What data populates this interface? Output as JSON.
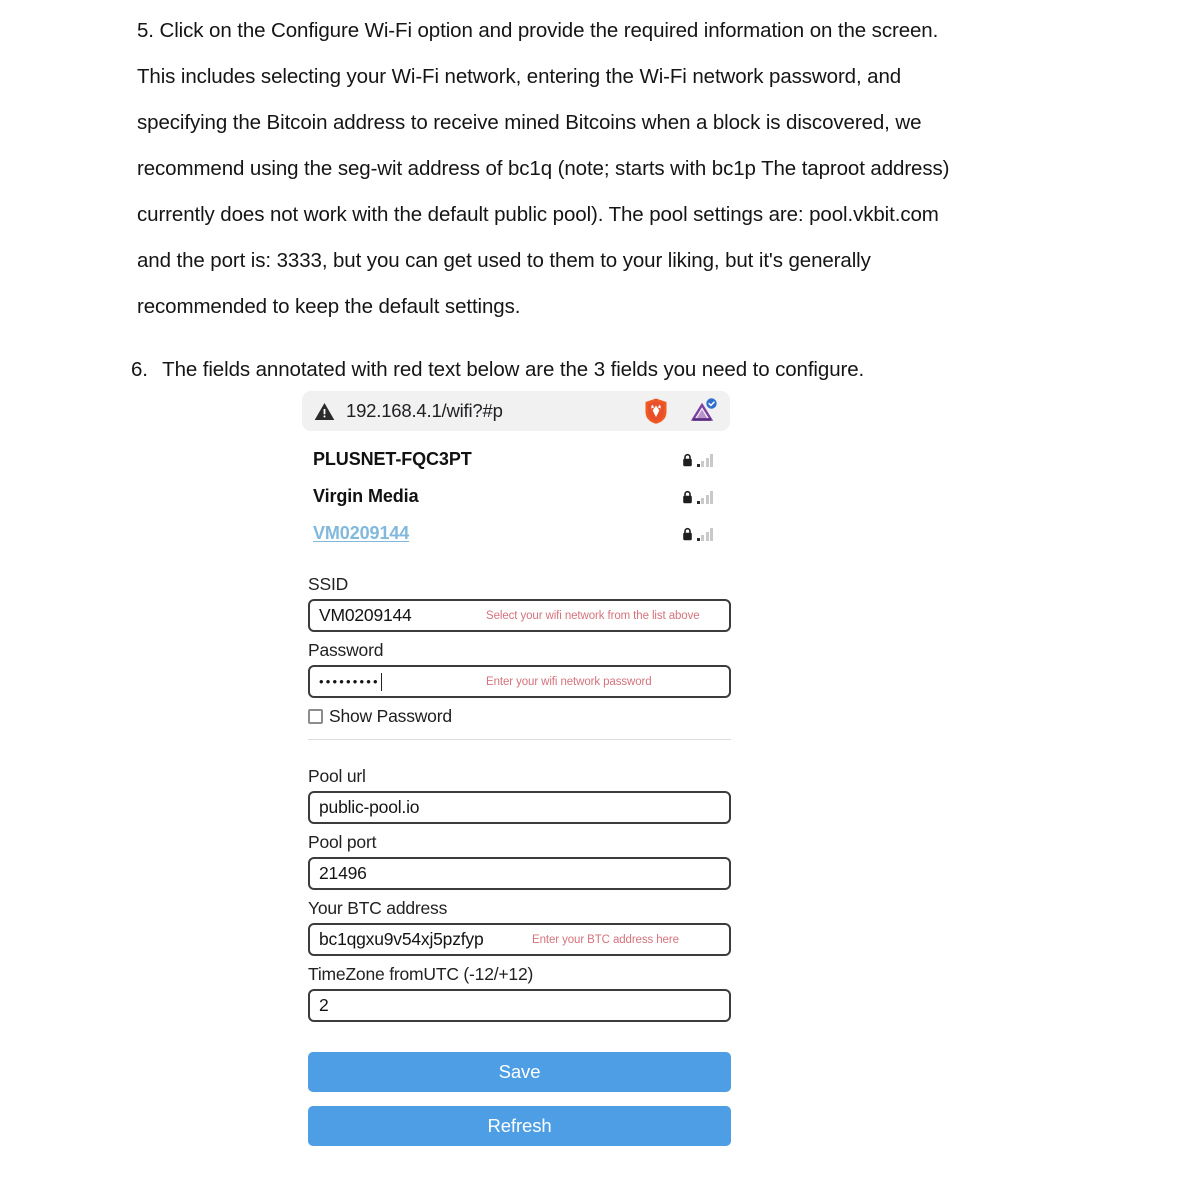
{
  "document": {
    "step5": {
      "number": "5.",
      "text": "Click on the Configure Wi-Fi option and provide the required information on the screen. This includes selecting your Wi-Fi network, entering the Wi-Fi network password, and specifying the Bitcoin address to receive mined Bitcoins when a block is discovered, we recommend using the seg-wit address of bc1q (note; starts with bc1p The taproot address) currently does not work with the default public pool). The pool settings are: pool.vkbit.com and the port is: 3333, but you can get used to them to your liking, but it's generally recommended to keep the default settings."
    },
    "step6": {
      "number": "6.",
      "text": "The fields annotated with red text below are the 3 fields you need to configure."
    }
  },
  "screenshot": {
    "browser": {
      "url": "192.168.4.1/wifi?#p",
      "warning_icon": "warning-triangle-icon",
      "brave_icon": "brave-lion-icon",
      "extension_icon": "extension-triangle-icon"
    },
    "networks": [
      {
        "ssid": "PLUSNET-FQC3PT",
        "selected": false,
        "lock": "lock-icon",
        "signal": "signal-bars-icon"
      },
      {
        "ssid": "Virgin Media",
        "selected": false,
        "lock": "lock-icon",
        "signal": "signal-bars-icon"
      },
      {
        "ssid": "VM0209144",
        "selected": true,
        "lock": "lock-icon",
        "signal": "signal-bars-icon"
      }
    ],
    "form": {
      "ssid": {
        "label": "SSID",
        "value": "VM0209144",
        "annotation": "Select your wifi network from the list above"
      },
      "password": {
        "label": "Password",
        "value": "•••••••••",
        "annotation": "Enter your wifi network password"
      },
      "show_password": {
        "label": "Show Password",
        "checked": false
      },
      "pool_url": {
        "label": "Pool url",
        "value": "public-pool.io",
        "annotation": ""
      },
      "pool_port": {
        "label": "Pool port",
        "value": "21496",
        "annotation": ""
      },
      "btc_address": {
        "label": "Your BTC address",
        "value": "bc1qgxu9v54xj5pzfyp",
        "annotation": "Enter your BTC address here"
      },
      "timezone": {
        "label": "TimeZone fromUTC (-12/+12)",
        "value": "2",
        "annotation": ""
      }
    },
    "buttons": {
      "save": "Save",
      "refresh": "Refresh"
    }
  },
  "colors": {
    "button_blue": "#4d9ee4",
    "annotation_red": "#d4737d",
    "link_blue": "#81b9dd",
    "urlbar_bg": "#f1f1f1"
  }
}
